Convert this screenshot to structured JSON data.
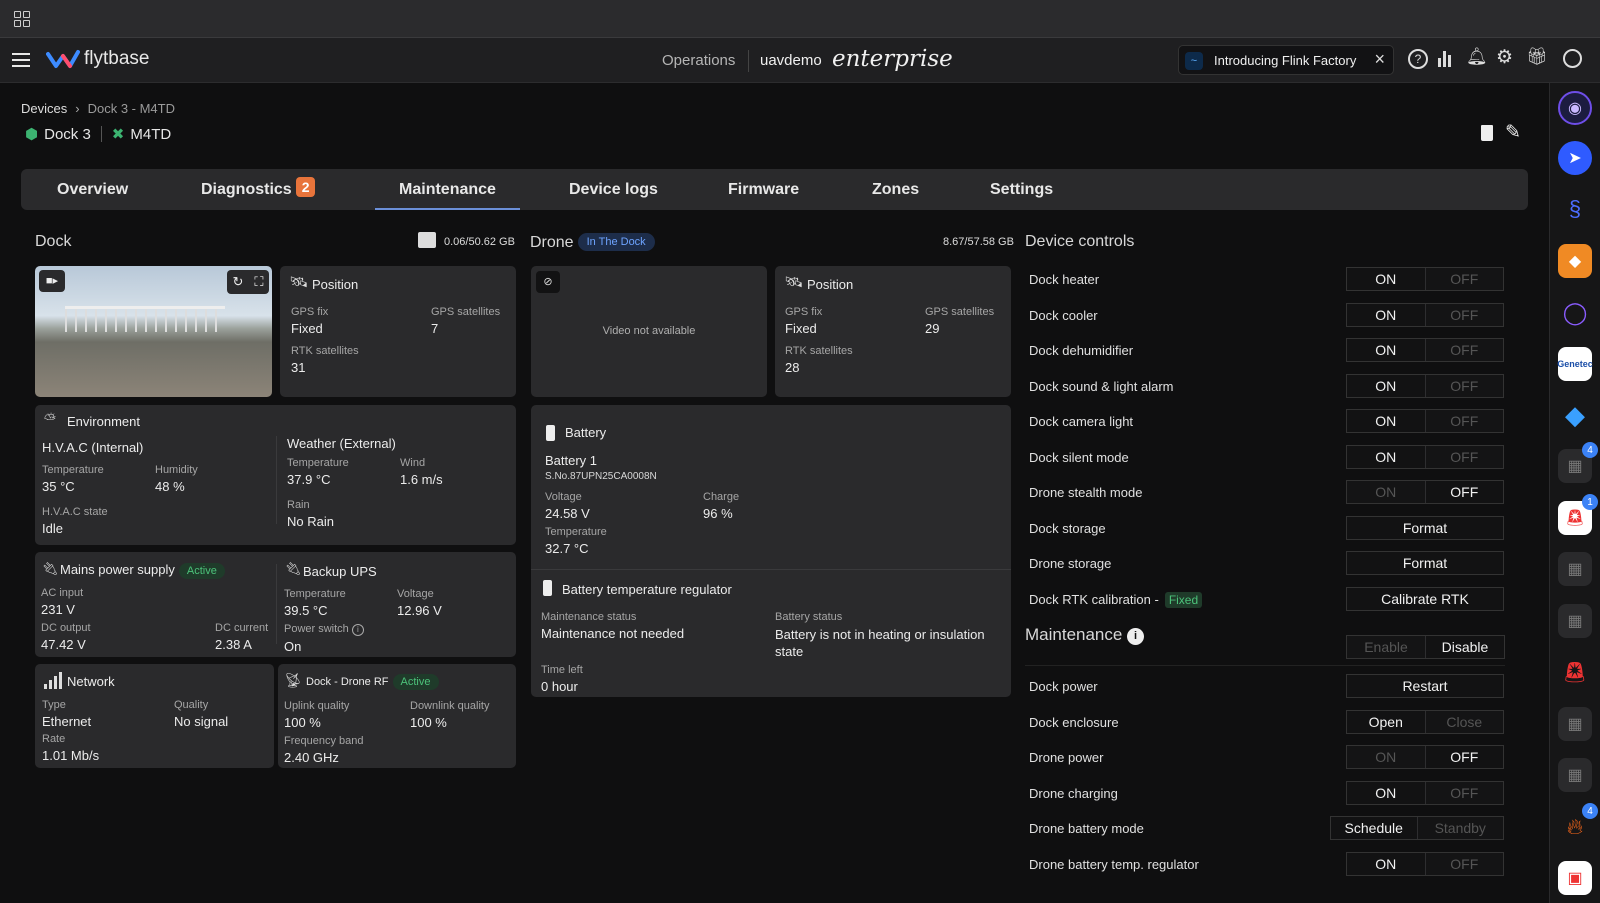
{
  "app": {
    "brand": "flytbase",
    "operations": "Operations",
    "org": "uavdemo",
    "edition": "enterprise",
    "banner": "Introducing Flink Factory"
  },
  "breadcrumb": {
    "root": "Devices",
    "sep": "›",
    "current": "Dock 3 - M4TD"
  },
  "device": {
    "dock": "Dock 3",
    "drone": "M4TD"
  },
  "tabs": [
    {
      "label": "Overview"
    },
    {
      "label": "Diagnostics",
      "badge": "2"
    },
    {
      "label": "Maintenance",
      "active": true
    },
    {
      "label": "Device logs"
    },
    {
      "label": "Firmware"
    },
    {
      "label": "Zones"
    },
    {
      "label": "Settings"
    }
  ],
  "dock": {
    "title": "Dock",
    "storage": "0.06/50.62 GB",
    "position": {
      "title": "Position",
      "gps_fix_label": "GPS fix",
      "gps_fix": "Fixed",
      "gps_sat_label": "GPS satellites",
      "gps_sat": "7",
      "rtk_label": "RTK satellites",
      "rtk": "31"
    },
    "environment": {
      "title": "Environment",
      "hvac_title": "H.V.A.C (Internal)",
      "temp_label": "Temperature",
      "temp": "35 °C",
      "hum_label": "Humidity",
      "hum": "48 %",
      "state_label": "H.V.A.C state",
      "state": "Idle",
      "weather_title": "Weather (External)",
      "wtemp_label": "Temperature",
      "wtemp": "37.9 °C",
      "wind_label": "Wind",
      "wind": "1.6 m/s",
      "rain_label": "Rain",
      "rain": "No Rain"
    },
    "mains": {
      "title": "Mains power supply",
      "status": "Active",
      "ac_label": "AC input",
      "ac": "231 V",
      "dcout_label": "DC output",
      "dcout": "47.42 V",
      "dccur_label": "DC current",
      "dccur": "2.38 A"
    },
    "ups": {
      "title": "Backup UPS",
      "temp_label": "Temperature",
      "temp": "39.5 °C",
      "volt_label": "Voltage",
      "volt": "12.96 V",
      "switch_label": "Power switch",
      "switch": "On"
    },
    "network": {
      "title": "Network",
      "type_label": "Type",
      "type": "Ethernet",
      "quality_label": "Quality",
      "quality": "No signal",
      "rate_label": "Rate",
      "rate": "1.01 Mb/s"
    },
    "rf": {
      "title": "Dock - Drone RF",
      "status": "Active",
      "up_label": "Uplink quality",
      "up": "100 %",
      "down_label": "Downlink quality",
      "down": "100 %",
      "band_label": "Frequency band",
      "band": "2.40 GHz"
    }
  },
  "drone": {
    "title": "Drone",
    "status": "In The Dock",
    "storage": "8.67/57.58 GB",
    "video": "Video not available",
    "position": {
      "title": "Position",
      "gps_fix_label": "GPS fix",
      "gps_fix": "Fixed",
      "gps_sat_label": "GPS satellites",
      "gps_sat": "29",
      "rtk_label": "RTK satellites",
      "rtk": "28"
    },
    "battery": {
      "title": "Battery",
      "name": "Battery 1",
      "serial": "S.No.87UPN25CA0008N",
      "volt_label": "Voltage",
      "volt": "24.58 V",
      "charge_label": "Charge",
      "charge": "96 %",
      "temp_label": "Temperature",
      "temp": "32.7 °C"
    },
    "regulator": {
      "title": "Battery temperature regulator",
      "mstatus_label": "Maintenance status",
      "mstatus": "Maintenance not needed",
      "bstatus_label": "Battery status",
      "bstatus": "Battery is not in heating or insulation state",
      "time_label": "Time left",
      "time": "0 hour"
    }
  },
  "controls": {
    "title": "Device controls",
    "rows": [
      {
        "label": "Dock heater",
        "a": "ON",
        "b": "OFF",
        "sel": "a"
      },
      {
        "label": "Dock cooler",
        "a": "ON",
        "b": "OFF",
        "sel": "a"
      },
      {
        "label": "Dock dehumidifier",
        "a": "ON",
        "b": "OFF",
        "sel": "a"
      },
      {
        "label": "Dock sound & light alarm",
        "a": "ON",
        "b": "OFF",
        "sel": "a"
      },
      {
        "label": "Dock camera light",
        "a": "ON",
        "b": "OFF",
        "sel": "a"
      },
      {
        "label": "Dock silent mode",
        "a": "ON",
        "b": "OFF",
        "sel": "a"
      },
      {
        "label": "Drone stealth mode",
        "a": "ON",
        "b": "OFF",
        "sel": "b"
      },
      {
        "label": "Dock storage",
        "single": "Format"
      },
      {
        "label": "Drone storage",
        "single": "Format"
      },
      {
        "label": "Dock RTK calibration -",
        "badge": "Fixed",
        "single": "Calibrate RTK"
      }
    ]
  },
  "maintenance": {
    "title": "Maintenance",
    "enable": "Enable",
    "disable": "Disable",
    "rows": [
      {
        "label": "Dock power",
        "single": "Restart"
      },
      {
        "label": "Dock enclosure",
        "a": "Open",
        "b": "Close",
        "sel": "a"
      },
      {
        "label": "Drone power",
        "a": "ON",
        "b": "OFF",
        "sel": "b"
      },
      {
        "label": "Drone charging",
        "a": "ON",
        "b": "OFF",
        "sel": "a"
      },
      {
        "label": "Drone battery mode",
        "a": "Schedule",
        "b": "Standby",
        "sel": "a",
        "wide": true
      },
      {
        "label": "Drone battery temp. regulator",
        "a": "ON",
        "b": "OFF",
        "sel": "a"
      }
    ]
  },
  "rail_badges": {
    "r7": "4",
    "r8": "1",
    "r14": "4"
  },
  "colors": {
    "accent": "#6b8fd8",
    "badge": "#e8743b",
    "active": "#4cc27a",
    "card": "#2a2a2c"
  }
}
